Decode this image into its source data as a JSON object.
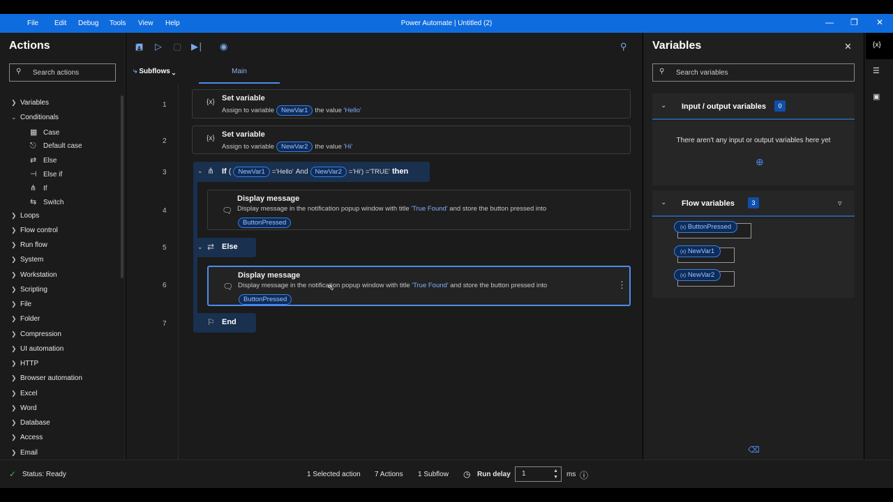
{
  "titlebar": {
    "menus": [
      "File",
      "Edit",
      "Debug",
      "Tools",
      "View",
      "Help"
    ],
    "title": "Power Automate | Untitled (2)"
  },
  "actions_pane": {
    "title": "Actions",
    "search_placeholder": "Search actions",
    "categories": [
      "Variables",
      "Conditionals",
      "Loops",
      "Flow control",
      "Run flow",
      "System",
      "Workstation",
      "Scripting",
      "File",
      "Folder",
      "Compression",
      "UI automation",
      "HTTP",
      "Browser automation",
      "Excel",
      "Word",
      "Database",
      "Access",
      "Email"
    ],
    "conditionals_children": [
      "Case",
      "Default case",
      "Else",
      "Else if",
      "If",
      "Switch"
    ]
  },
  "designer": {
    "subflows_label": "Subflows",
    "main_tab": "Main",
    "line_numbers": [
      "1",
      "2",
      "3",
      "4",
      "5",
      "6",
      "7"
    ],
    "step1": {
      "title": "Set variable",
      "prefix": "Assign to variable",
      "var": "NewVar1",
      "mid": "the value",
      "value": "'Hello'"
    },
    "step2": {
      "title": "Set variable",
      "prefix": "Assign to variable",
      "var": "NewVar2",
      "mid": "the value",
      "value": "'Hi'"
    },
    "step3": {
      "if": "If",
      "open": "(",
      "var1": "NewVar1",
      "cmp1": "='Hello'",
      "and": "And",
      "var2": "NewVar2",
      "cmp2": "='Hi') ='TRUE'",
      "then": "then"
    },
    "step4": {
      "title": "Display message",
      "desc1": "Display message  in the notification popup window with title",
      "title_value": "'True Found'",
      "desc2": "and store the button pressed into",
      "var": "ButtonPressed"
    },
    "step5": {
      "label": "Else"
    },
    "step6": {
      "title": "Display message",
      "desc1": "Display message  in the notification popup window with title",
      "title_value": "'True Found'",
      "desc2": "and store the button pressed into",
      "var": "ButtonPressed"
    },
    "step7": {
      "label": "End"
    }
  },
  "variables_pane": {
    "title": "Variables",
    "search_placeholder": "Search variables",
    "io_label": "Input / output variables",
    "io_count": "0",
    "io_empty": "There aren't any input or output variables here yet",
    "flow_label": "Flow variables",
    "flow_count": "3",
    "flow_vars": [
      "ButtonPressed",
      "NewVar1",
      "NewVar2"
    ],
    "var_prefix": "(x)"
  },
  "right_rail": {
    "vars_icon": "{x}"
  },
  "status": {
    "state": "Status: Ready",
    "selected": "1 Selected action",
    "actions": "7 Actions",
    "subflows": "1 Subflow",
    "run_delay_label": "Run delay",
    "run_delay_value": "1",
    "unit": "ms"
  },
  "colors": {
    "accent": "#0f6cde",
    "pill_border": "#3d7fe0",
    "string_value": "#7fb0ff"
  },
  "icons": [
    "search-icon",
    "save-icon",
    "run-icon",
    "stop-icon",
    "step-icon",
    "record-icon",
    "close-icon",
    "chevron-icon",
    "filter-icon",
    "add-icon",
    "eraser-icon",
    "layers-icon",
    "image-icon",
    "info-icon",
    "clock-icon",
    "status-ok-icon",
    "flag-icon",
    "more-icon"
  ]
}
